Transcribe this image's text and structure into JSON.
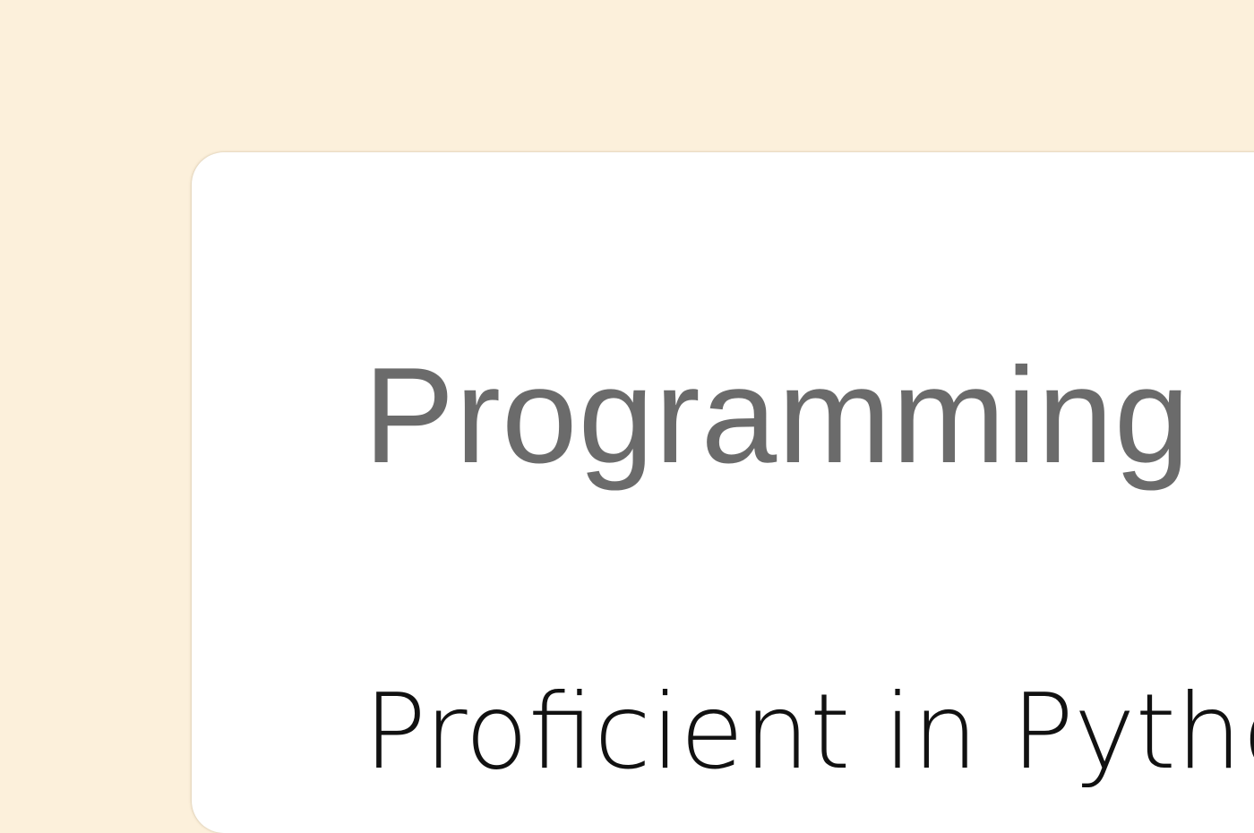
{
  "card": {
    "title": "Programming",
    "description": "Proficient in Python"
  },
  "colors": {
    "page_background": "#fcf0db",
    "card_background": "#ffffff",
    "title_text": "#6b6b6b",
    "body_text": "#111111"
  }
}
